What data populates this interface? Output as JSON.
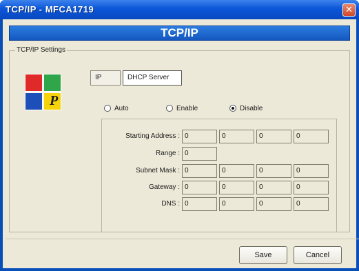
{
  "window": {
    "title": "TCP/IP - MFCA1719",
    "close_symbol": "✕"
  },
  "banner": {
    "title": "TCP/IP"
  },
  "group": {
    "label": "TCP/IP Settings"
  },
  "logo": {
    "letter": "P"
  },
  "tabs": [
    {
      "label": "IP",
      "selected": false
    },
    {
      "label": "DHCP Server",
      "selected": true
    }
  ],
  "radios": [
    {
      "label": "Auto",
      "checked": false
    },
    {
      "label": "Enable",
      "checked": false
    },
    {
      "label": "Disable",
      "checked": true
    }
  ],
  "fields": {
    "starting_address": {
      "label": "Starting Address :",
      "values": [
        "0",
        "0",
        "0",
        "0"
      ]
    },
    "range": {
      "label": "Range :",
      "values": [
        "0"
      ]
    },
    "subnet_mask": {
      "label": "Subnet Mask :",
      "values": [
        "0",
        "0",
        "0",
        "0"
      ]
    },
    "gateway": {
      "label": "Gateway :",
      "values": [
        "0",
        "0",
        "0",
        "0"
      ]
    },
    "dns": {
      "label": "DNS :",
      "values": [
        "0",
        "0",
        "0",
        "0"
      ]
    }
  },
  "buttons": {
    "save": "Save",
    "cancel": "Cancel"
  },
  "colors": {
    "titlebar": "#0b56d8",
    "banner": "#1e6ad6",
    "client": "#ece9d8",
    "close": "#d2482a"
  }
}
